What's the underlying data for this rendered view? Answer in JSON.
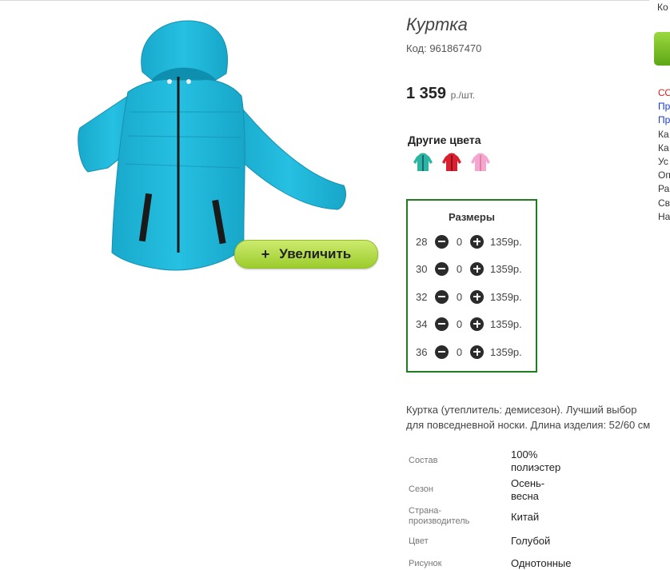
{
  "product": {
    "title": "Куртка",
    "code": "Код: 961867470",
    "price": "1 359",
    "price_unit": "р./шт.",
    "zoom_button": "+  Увеличить",
    "zoom_plus": "+",
    "zoom_label": "Увеличить"
  },
  "other_colors": {
    "title": "Другие цвета",
    "swatches": [
      {
        "icon": "jacket-teal-icon",
        "color": "#2bb5a0"
      },
      {
        "icon": "jacket-red-icon",
        "color": "#d82030"
      },
      {
        "icon": "jacket-pink-icon",
        "color": "#f4a6d0"
      }
    ]
  },
  "sizes": {
    "title": "Размеры",
    "rows": [
      {
        "size": "28",
        "qty": "0",
        "price": "1359р."
      },
      {
        "size": "30",
        "qty": "0",
        "price": "1359р."
      },
      {
        "size": "32",
        "qty": "0",
        "price": "1359р."
      },
      {
        "size": "34",
        "qty": "0",
        "price": "1359р."
      },
      {
        "size": "36",
        "qty": "0",
        "price": "1359р."
      }
    ]
  },
  "description": {
    "line1": "Куртка (утеплитель: демисезон). Лучший выбор",
    "line2": "для повседневной носки. Длина изделия: 52/60 см"
  },
  "specs": [
    {
      "label": "Состав",
      "value_lines": [
        "100%",
        "полиэстер"
      ]
    },
    {
      "label": "Сезон",
      "value_lines": [
        "Осень-",
        "весна"
      ]
    },
    {
      "label": "Страна-\nпроизводитель",
      "label_lines": [
        "Страна-",
        "производитель"
      ],
      "value_lines": [
        "Китай"
      ]
    },
    {
      "label": "Цвет",
      "value_lines": [
        "Голубой"
      ]
    },
    {
      "label": "Рисунок",
      "value_lines": [
        "Однотонные"
      ]
    }
  ],
  "sidebar": {
    "cutoff_top": "Ко",
    "links": [
      {
        "text": "СО",
        "style": "red"
      },
      {
        "text": "Пр",
        "style": "blue"
      },
      {
        "text": "Пр",
        "style": "blue"
      },
      {
        "text": "Ка",
        "style": "dark"
      },
      {
        "text": "Ка",
        "style": "dark"
      },
      {
        "text": "Ус",
        "style": "dark"
      },
      {
        "text": "Оп",
        "style": "dark"
      },
      {
        "text": "Ра",
        "style": "dark"
      },
      {
        "text": "Св",
        "style": "dark"
      },
      {
        "text": "На",
        "style": "dark"
      }
    ]
  },
  "colors": {
    "jacket": "#1fb6d8",
    "frame_green": "#1e7e1e",
    "zoom_button": "#b5dc47"
  }
}
